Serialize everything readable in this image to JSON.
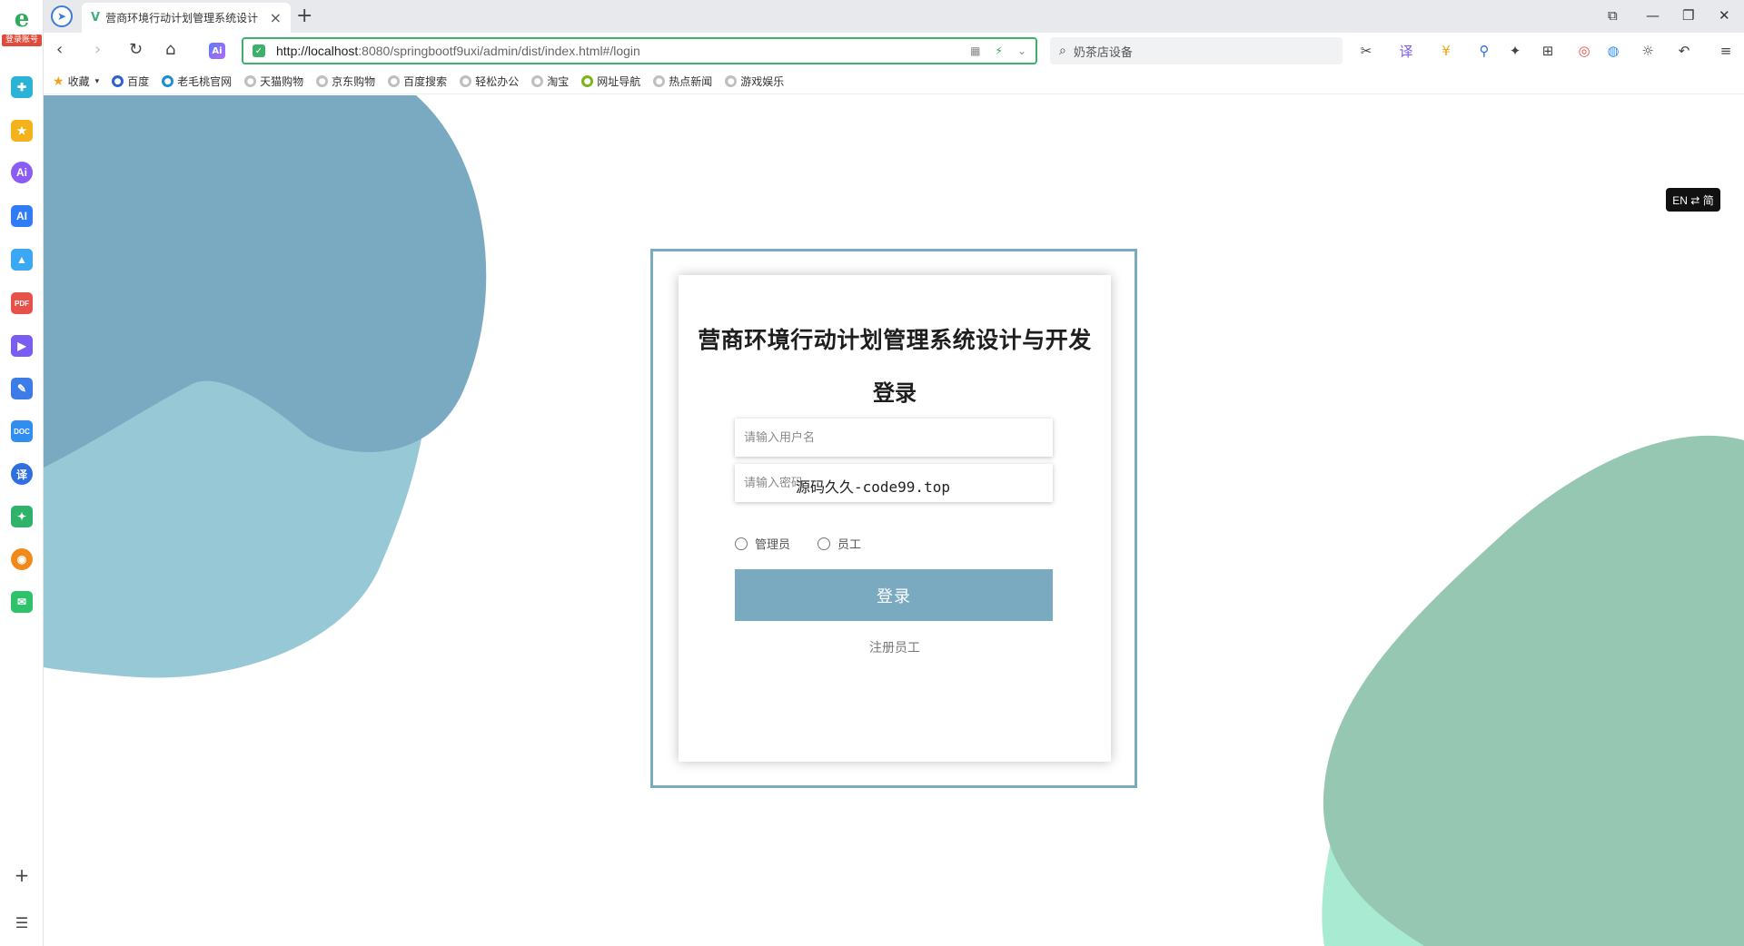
{
  "browser": {
    "logo_badge": "登录账号",
    "tab_title": "营商环境行动计划管理系统设计",
    "tab_close": "×",
    "new_tab": "+",
    "url_host": "http://localhost",
    "url_path": ":8080/springbootf9uxi/admin/dist/index.html#/login",
    "search_text": "奶茶店设备",
    "window_controls": [
      "⧉",
      "—",
      "❐",
      "✕"
    ]
  },
  "bookmarks": [
    {
      "label": "收藏",
      "icon": "star-icon"
    },
    {
      "label": "百度",
      "icon": "baidu-icon"
    },
    {
      "label": "老毛桃官网",
      "icon": "globe-icon"
    },
    {
      "label": "天猫购物",
      "icon": "globe-icon"
    },
    {
      "label": "京东购物",
      "icon": "globe-icon"
    },
    {
      "label": "百度搜索",
      "icon": "globe-icon"
    },
    {
      "label": "轻松办公",
      "icon": "globe-icon"
    },
    {
      "label": "淘宝",
      "icon": "globe-icon"
    },
    {
      "label": "网址导航",
      "icon": "globe-icon"
    },
    {
      "label": "热点新闻",
      "icon": "globe-icon"
    },
    {
      "label": "游戏娱乐",
      "icon": "globe-icon"
    }
  ],
  "lang_toggle": "EN ⇄ 简",
  "login": {
    "title": "营商环境行动计划管理系统设计与开发",
    "subtitle": "登录",
    "username_placeholder": "请输入用户名",
    "password_placeholder": "请输入密码",
    "watermark": "源码久久-code99.top",
    "roles": [
      "管理员",
      "员工"
    ],
    "login_button": "登录",
    "register_link": "注册员工"
  },
  "colors": {
    "accent": "#79aac0",
    "blob_dark_blue": "#7aaac1",
    "blob_light_blue": "#97c8d5",
    "blob_green": "#95c7b2",
    "blob_mint": "#a9ead3",
    "url_border": "#3db06a"
  }
}
